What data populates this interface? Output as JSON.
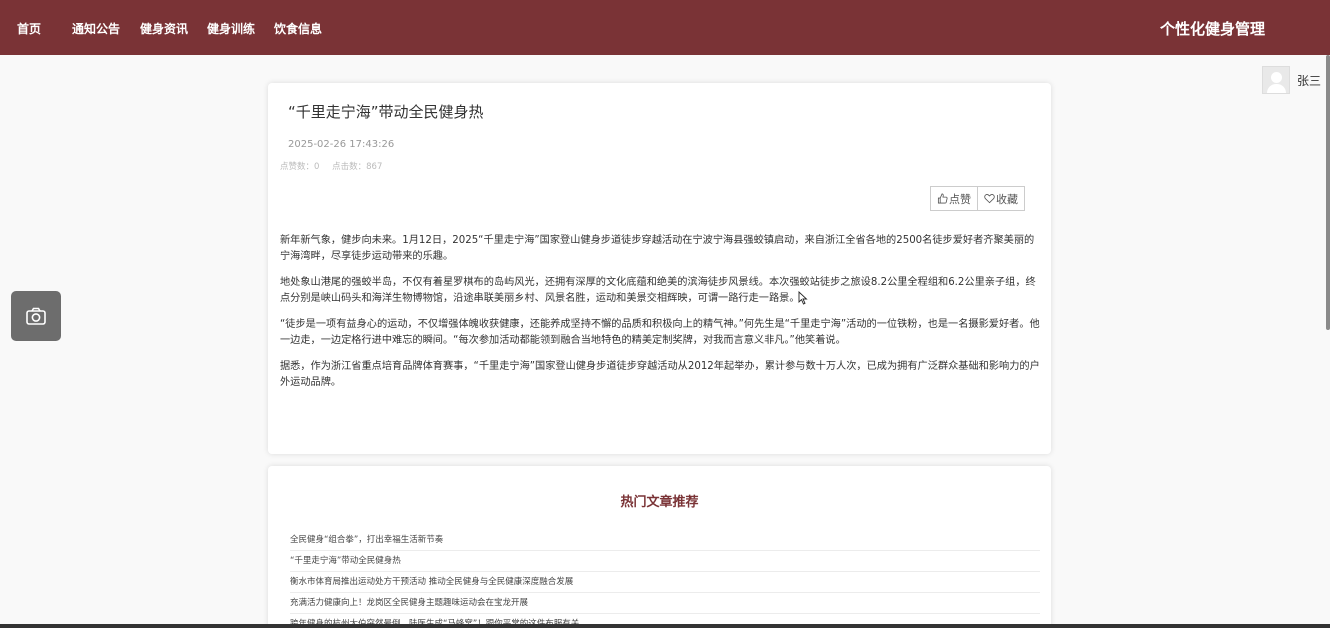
{
  "nav": {
    "items": [
      {
        "label": "首页"
      },
      {
        "label": "通知公告"
      },
      {
        "label": "健身资讯"
      },
      {
        "label": "健身训练"
      },
      {
        "label": "饮食信息"
      }
    ],
    "brand": "个性化健身管理"
  },
  "user": {
    "name": "张三"
  },
  "article": {
    "title": "“千里走宁海”带动全民健身热",
    "date": "2025-02-26 17:43:26",
    "likes_label": "点赞数：0",
    "clicks_label": "点击数：867",
    "like_button": "点赞",
    "favorite_button": "收藏",
    "paragraphs": [
      "新年新气象，健步向未来。1月12日，2025“千里走宁海”国家登山健身步道徒步穿越活动在宁波宁海县强蛟镇启动，来自浙江全省各地的2500名徒步爱好者齐聚美丽的宁海湾畔，尽享徒步运动带来的乐趣。",
      "地处象山港尾的强蛟半岛，不仅有着星罗棋布的岛屿风光，还拥有深厚的文化底蕴和绝美的滨海徒步风景线。本次强蛟站徒步之旅设8.2公里全程组和6.2公里亲子组，终点分别是峡山码头和海洋生物博物馆，沿途串联美丽乡村、风景名胜，运动和美景交相辉映，可谓一路行走一路景。",
      "“徒步是一项有益身心的运动，不仅增强体魄收获健康，还能养成坚持不懈的品质和积极向上的精气神。”何先生是“千里走宁海”活动的一位铁粉，也是一名摄影爱好者。他一边走，一边定格行进中难忘的瞬间。“每次参加活动都能领到融合当地特色的精美定制奖牌，对我而言意义非凡。”他笑着说。",
      "据悉，作为浙江省重点培育品牌体育赛事，“千里走宁海”国家登山健身步道徒步穿越活动从2012年起举办，累计参与数十万人次，已成为拥有广泛群众基础和影响力的户外运动品牌。"
    ]
  },
  "hot": {
    "title": "热门文章推荐",
    "items": [
      "全民健身“组合拳”，打出幸福生活新节奏",
      "“千里走宁海”带动全民健身热",
      "衡水市体育局推出运动处方干预活动 推动全民健身与全民健康深度融合发展",
      "充满活力健康向上！龙岗区全民健身主题趣味运动会在宝龙开展",
      "跨年健身的杭州大伯突然晕倒，陆医生成“马蜂窝”！跟你平常的这件布服有关"
    ]
  },
  "colors": {
    "brand": "#7a3336",
    "background": "#f9f9f9"
  }
}
